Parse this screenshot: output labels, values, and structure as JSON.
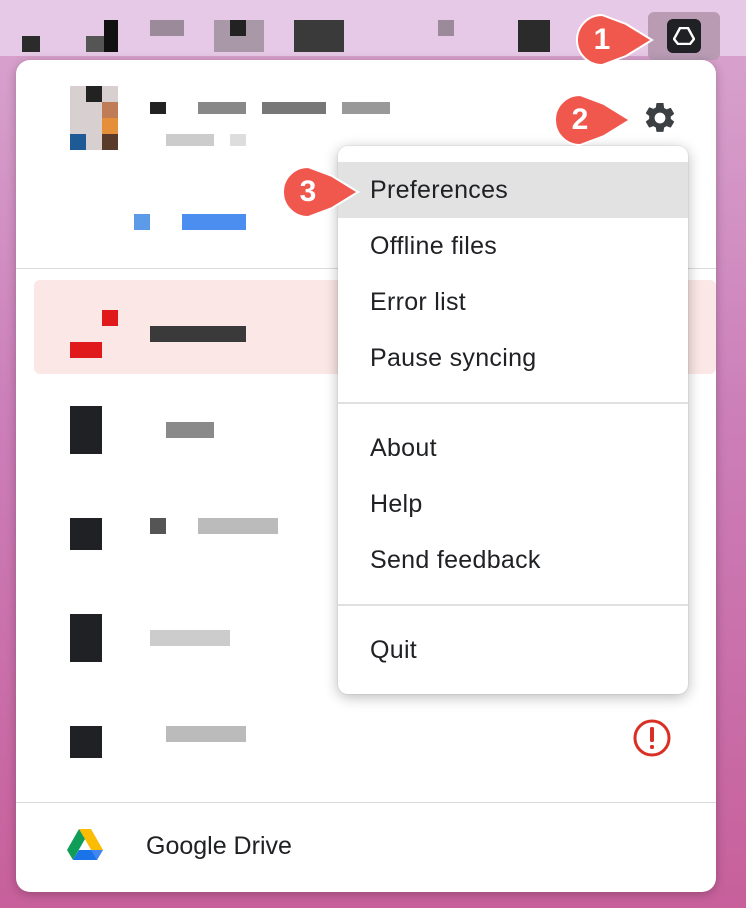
{
  "app": {
    "footer_title": "Google Drive"
  },
  "menu": {
    "items": [
      {
        "label": "Preferences",
        "selected": true
      },
      {
        "label": "Offline files"
      },
      {
        "label": "Error list"
      },
      {
        "label": "Pause syncing"
      },
      {
        "label": "About"
      },
      {
        "label": "Help"
      },
      {
        "label": "Send feedback"
      },
      {
        "label": "Quit"
      }
    ]
  },
  "callouts": [
    {
      "number": "1",
      "target": "tray-drive-icon"
    },
    {
      "number": "2",
      "target": "settings-gear"
    },
    {
      "number": "3",
      "target": "preferences-menu-item"
    }
  ],
  "icons": {
    "tray": "google-drive-tray-icon",
    "settings": "gear-icon",
    "alert": "error-alert-icon",
    "logo": "google-drive-logo"
  },
  "colors": {
    "callout": "#f0584d",
    "alert": "#d93025",
    "selected_item_bg": "#e2e2e2",
    "error_row_bg": "#fbe7e6"
  }
}
